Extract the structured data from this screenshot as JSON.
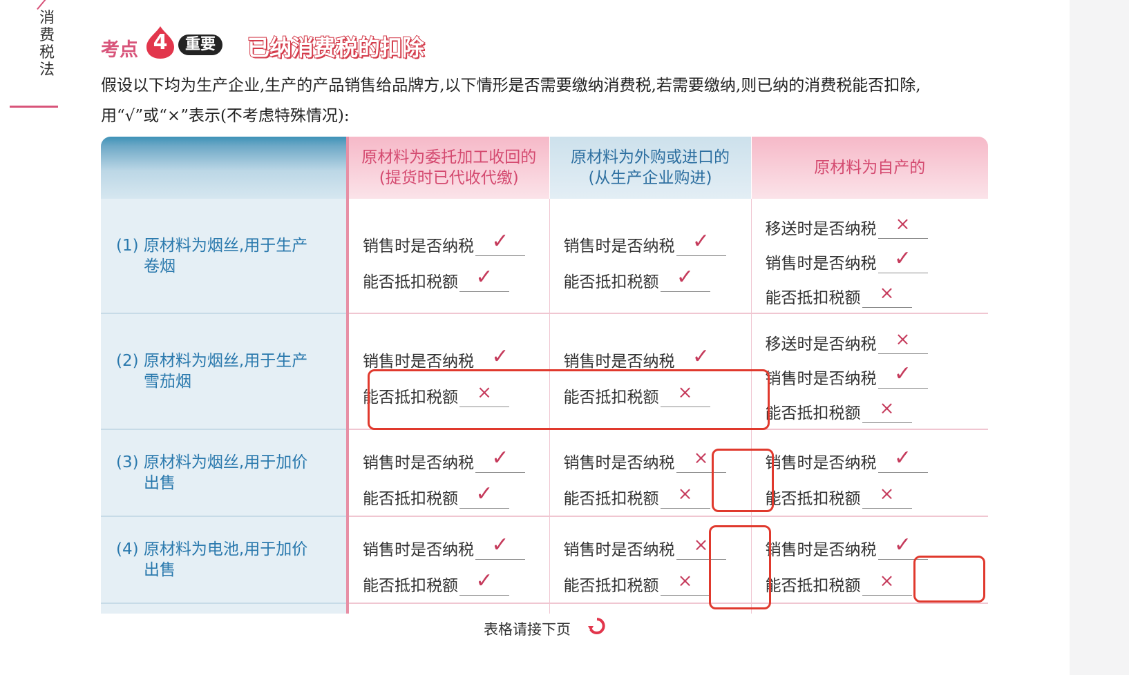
{
  "sidebar": {
    "chapter_chars": [
      "消",
      "费",
      "税",
      "法"
    ]
  },
  "header": {
    "kaodian": "考点",
    "number": "4",
    "tag": "重要",
    "topic": "已纳消费税的扣除"
  },
  "intro": "假设以下均为生产企业,生产的产品销售给品牌方,以下情形是否需要缴纳消费税,若需要缴纳,则已纳的消费税能否扣除,用“√”或“×”表示(不考虑特殊情况):",
  "table": {
    "headers": [
      {
        "line1": "",
        "line2": ""
      },
      {
        "line1": "原材料为委托加工收回的",
        "line2": "(提货时已代收代缴)"
      },
      {
        "line1": "原材料为外购或进口的",
        "line2": "(从生产企业购进)"
      },
      {
        "line1": "原材料为自产的",
        "line2": ""
      }
    ],
    "rows": [
      {
        "label_line1": "(1) 原材料为烟丝,用于生产",
        "label_line2": "卷烟",
        "cols": [
          [
            {
              "q": "销售时是否纳税",
              "a": "✓"
            },
            {
              "q": "能否抵扣税额",
              "a": "✓"
            }
          ],
          [
            {
              "q": "销售时是否纳税",
              "a": "✓"
            },
            {
              "q": "能否抵扣税额",
              "a": "✓"
            }
          ],
          [
            {
              "q": "移送时是否纳税",
              "a": "×"
            },
            {
              "q": "销售时是否纳税",
              "a": "✓"
            },
            {
              "q": "能否抵扣税额",
              "a": "×"
            }
          ]
        ]
      },
      {
        "label_line1": "(2) 原材料为烟丝,用于生产",
        "label_line2": "雪茄烟",
        "cols": [
          [
            {
              "q": "销售时是否纳税",
              "a": "✓"
            },
            {
              "q": "能否抵扣税额",
              "a": "×"
            }
          ],
          [
            {
              "q": "销售时是否纳税",
              "a": "✓"
            },
            {
              "q": "能否抵扣税额",
              "a": "×"
            }
          ],
          [
            {
              "q": "移送时是否纳税",
              "a": "×"
            },
            {
              "q": "销售时是否纳税",
              "a": "✓"
            },
            {
              "q": "能否抵扣税额",
              "a": "×"
            }
          ]
        ]
      },
      {
        "label_line1": "(3) 原材料为烟丝,用于加价",
        "label_line2": "出售",
        "cols": [
          [
            {
              "q": "销售时是否纳税",
              "a": "✓"
            },
            {
              "q": "能否抵扣税额",
              "a": "✓"
            }
          ],
          [
            {
              "q": "销售时是否纳税",
              "a": "×"
            },
            {
              "q": "能否抵扣税额",
              "a": "×"
            }
          ],
          [
            {
              "q": "销售时是否纳税",
              "a": "✓"
            },
            {
              "q": "能否抵扣税额",
              "a": "×"
            }
          ]
        ]
      },
      {
        "label_line1": "(4) 原材料为电池,用于加价",
        "label_line2": "出售",
        "cols": [
          [
            {
              "q": "销售时是否纳税",
              "a": "✓"
            },
            {
              "q": "能否抵扣税额",
              "a": "✓"
            }
          ],
          [
            {
              "q": "销售时是否纳税",
              "a": "×"
            },
            {
              "q": "能否抵扣税额",
              "a": "×"
            }
          ],
          [
            {
              "q": "销售时是否纳税",
              "a": "✓"
            },
            {
              "q": "能否抵扣税额",
              "a": "×"
            }
          ]
        ]
      }
    ]
  },
  "footer": {
    "continue_text": "表格请接下页"
  },
  "colors": {
    "accent_pink": "#d8547a",
    "label_blue": "#2a79ad",
    "highlight_red": "#e0392d"
  }
}
